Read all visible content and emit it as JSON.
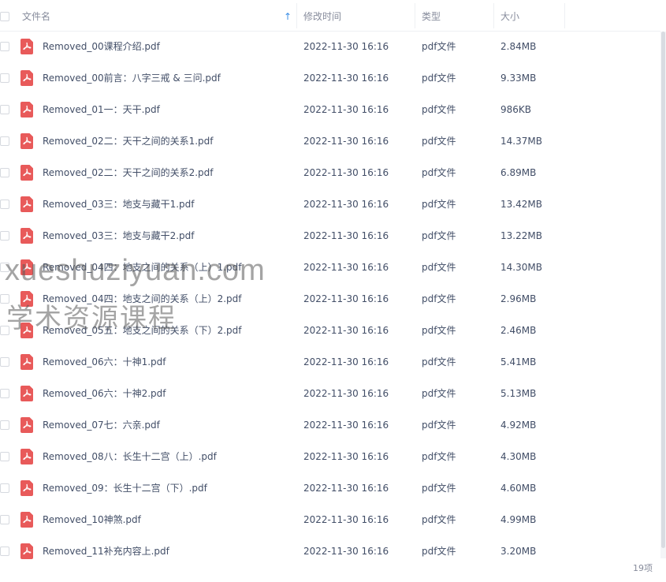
{
  "header": {
    "name_label": "文件名",
    "time_label": "修改时间",
    "type_label": "类型",
    "size_label": "大小",
    "sort_arrow": "↑"
  },
  "files": [
    {
      "name": "Removed_00课程介绍.pdf",
      "time": "2022-11-30 16:16",
      "type": "pdf文件",
      "size": "2.84MB"
    },
    {
      "name": "Removed_00前言：八字三戒 & 三问.pdf",
      "time": "2022-11-30 16:16",
      "type": "pdf文件",
      "size": "9.33MB"
    },
    {
      "name": "Removed_01一：天干.pdf",
      "time": "2022-11-30 16:16",
      "type": "pdf文件",
      "size": "986KB"
    },
    {
      "name": "Removed_02二：天干之间的关系1.pdf",
      "time": "2022-11-30 16:16",
      "type": "pdf文件",
      "size": "14.37MB"
    },
    {
      "name": "Removed_02二：天干之间的关系2.pdf",
      "time": "2022-11-30 16:16",
      "type": "pdf文件",
      "size": "6.89MB"
    },
    {
      "name": "Removed_03三：地支与藏干1.pdf",
      "time": "2022-11-30 16:16",
      "type": "pdf文件",
      "size": "13.42MB"
    },
    {
      "name": "Removed_03三：地支与藏干2.pdf",
      "time": "2022-11-30 16:16",
      "type": "pdf文件",
      "size": "13.22MB"
    },
    {
      "name": "Removed_04四：地支之间的关系（上）1.pdf",
      "time": "2022-11-30 16:16",
      "type": "pdf文件",
      "size": "14.30MB"
    },
    {
      "name": "Removed_04四：地支之间的关系（上）2.pdf",
      "time": "2022-11-30 16:16",
      "type": "pdf文件",
      "size": "2.96MB"
    },
    {
      "name": "Removed_05五：地支之间的关系（下）2.pdf",
      "time": "2022-11-30 16:16",
      "type": "pdf文件",
      "size": "2.46MB"
    },
    {
      "name": "Removed_06六：十神1.pdf",
      "time": "2022-11-30 16:16",
      "type": "pdf文件",
      "size": "5.41MB"
    },
    {
      "name": "Removed_06六：十神2.pdf",
      "time": "2022-11-30 16:16",
      "type": "pdf文件",
      "size": "5.13MB"
    },
    {
      "name": "Removed_07七：六亲.pdf",
      "time": "2022-11-30 16:16",
      "type": "pdf文件",
      "size": "4.92MB"
    },
    {
      "name": "Removed_08八：长生十二宫（上）.pdf",
      "time": "2022-11-30 16:16",
      "type": "pdf文件",
      "size": "4.30MB"
    },
    {
      "name": "Removed_09：长生十二宫（下）.pdf",
      "time": "2022-11-30 16:16",
      "type": "pdf文件",
      "size": "4.60MB"
    },
    {
      "name": "Removed_10神煞.pdf",
      "time": "2022-11-30 16:16",
      "type": "pdf文件",
      "size": "4.99MB"
    },
    {
      "name": "Removed_11补充内容上.pdf",
      "time": "2022-11-30 16:16",
      "type": "pdf文件",
      "size": "3.20MB"
    }
  ],
  "footer": {
    "count": "19项"
  },
  "watermark": {
    "en": "xueshuziyuan.com",
    "cn": "学术资源课程"
  },
  "icons": {
    "file": "pdf-file-icon",
    "sort": "sort-ascending-icon"
  },
  "colors": {
    "pdf_icon": "#e85a5a",
    "sort_arrow": "#3a8ee6"
  }
}
